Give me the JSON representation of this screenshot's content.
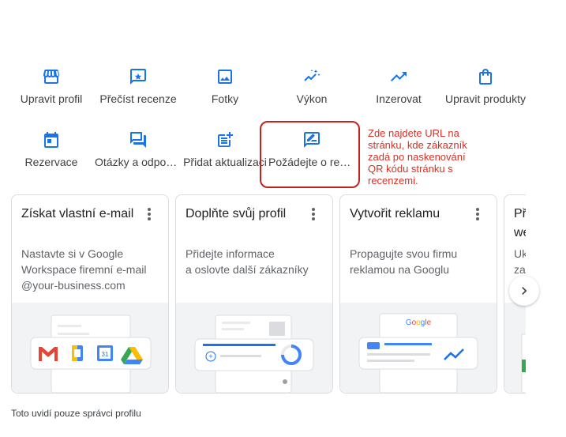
{
  "actions": [
    {
      "label": "Upravit profil",
      "icon": "storefront-icon"
    },
    {
      "label": "Přečíst recenze",
      "icon": "review-icon"
    },
    {
      "label": "Fotky",
      "icon": "photo-icon"
    },
    {
      "label": "Výkon",
      "icon": "performance-icon"
    },
    {
      "label": "Inzerovat",
      "icon": "trending-up-icon"
    },
    {
      "label": "Upravit produkty",
      "icon": "shopping-bag-icon"
    },
    {
      "label": "Rezervace",
      "icon": "calendar-icon"
    },
    {
      "label": "Otázky a odpovědi",
      "icon": "forum-icon"
    },
    {
      "label": "Přidat aktualizaci",
      "icon": "post-add-icon"
    },
    {
      "label": "Požádejte o recenze",
      "icon": "rate-review-icon"
    }
  ],
  "annotation": {
    "text": "Zde najdete URL na\nstránku, kde zákazník\nzadá po naskenování\nQR kódu stránku s\n recenzemi.",
    "color": "#d93025"
  },
  "cards": [
    {
      "title": "Získat vlastní e-mail",
      "description": "Nastavte si v Google Workspace firemní e-mail @your-business.com"
    },
    {
      "title": "Doplňte svůj profil",
      "description": "Přidejte informace\na oslovte další zákazníky"
    },
    {
      "title": "Vytvořit reklamu",
      "description": "Propagujte svou firmu reklamou na Googlu",
      "illustration_logo": "Google"
    },
    {
      "title": "Př\nwe",
      "description": "Uk\nza"
    }
  ],
  "footer": "Toto uvidí pouze správci profilu",
  "colors": {
    "accent": "#1a73e8",
    "gmail_red": "#ea4335",
    "docs_yellow": "#fbbc04",
    "sheets_green": "#34a853"
  }
}
